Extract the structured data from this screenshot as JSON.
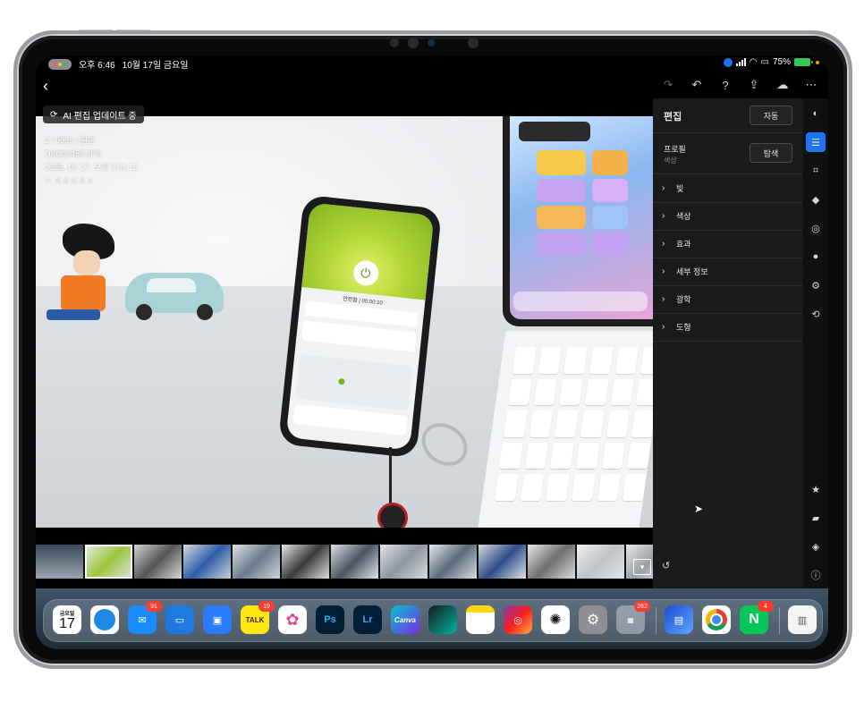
{
  "status_bar": {
    "time": "오후 6:46",
    "date": "10월 17일 금요일",
    "battery": "75%"
  },
  "photo": {
    "ai_chip": "AI 편집 업데이트 중",
    "index": "2 / 6995 | 원본",
    "filename": "DSC02458.JPG",
    "datetime": "2025. 10. 17. 오전 3:51:12",
    "rating": "☆☆☆☆☆"
  },
  "phone_screen": {
    "connected": "안전함 | 00:00:10"
  },
  "edit_panel": {
    "title": "편집",
    "auto_button": "자동",
    "profile_label": "프로필",
    "profile_value": "색상",
    "browse_button": "탐색",
    "sections": [
      "빛",
      "색상",
      "효과",
      "세부 정보",
      "광학",
      "도형"
    ]
  },
  "dock": {
    "calendar_day_label": "금요일",
    "calendar_day": "17",
    "apps": [
      {
        "name": "Calendar"
      },
      {
        "name": "Safari"
      },
      {
        "name": "Mail",
        "badge": "91"
      },
      {
        "name": "Files"
      },
      {
        "name": "AppStore"
      },
      {
        "name": "KakaoTalk",
        "label": "TALK",
        "badge": "19"
      },
      {
        "name": "Photos"
      },
      {
        "name": "Photoshop",
        "label": "Ps"
      },
      {
        "name": "Lightroom",
        "label": "Lr"
      },
      {
        "name": "Canva",
        "label": "Canva"
      },
      {
        "name": "Final Cut"
      },
      {
        "name": "Notes"
      },
      {
        "name": "Instagram"
      },
      {
        "name": "ChatGPT"
      },
      {
        "name": "Settings"
      },
      {
        "name": "Folder",
        "badge": "262"
      },
      {
        "name": "Files2"
      },
      {
        "name": "Chrome"
      },
      {
        "name": "Naver",
        "label": "N",
        "badge": "4"
      },
      {
        "name": "Recent"
      }
    ]
  }
}
